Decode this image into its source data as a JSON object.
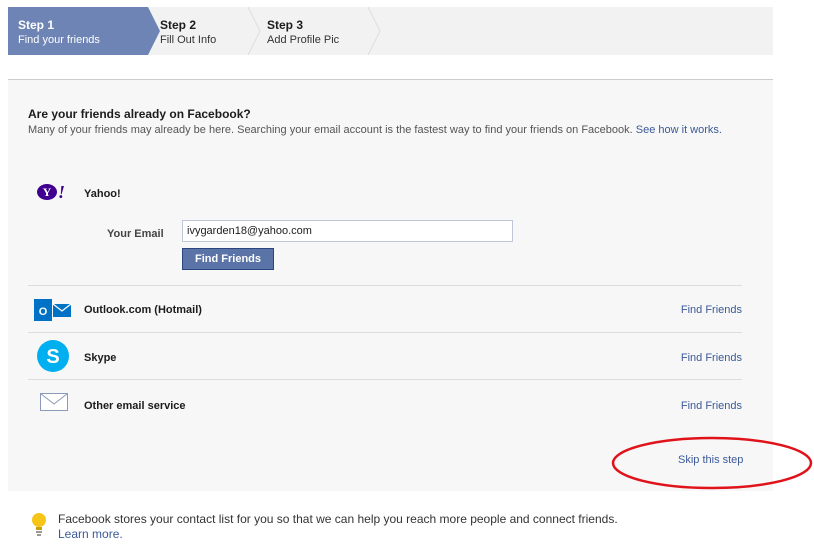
{
  "steps": [
    {
      "num": "Step 1",
      "label": "Find your friends"
    },
    {
      "num": "Step 2",
      "label": "Fill Out Info"
    },
    {
      "num": "Step 3",
      "label": "Add Profile Pic"
    }
  ],
  "main": {
    "heading": "Are your friends already on Facebook?",
    "description": "Many of your friends may already be here. Searching your email account is the fastest way to find your friends on Facebook.",
    "how_link": "See how it works."
  },
  "yahoo": {
    "name": "Yahoo!",
    "email_label": "Your Email",
    "email_value": "ivygarden18@yahoo.com",
    "button_label": "Find Friends"
  },
  "providers": [
    {
      "name": "Outlook.com (Hotmail)",
      "action": "Find Friends",
      "icon": "outlook-icon"
    },
    {
      "name": "Skype",
      "action": "Find Friends",
      "icon": "skype-icon"
    },
    {
      "name": "Other email service",
      "action": "Find Friends",
      "icon": "envelope-icon"
    }
  ],
  "skip_label": "Skip this step",
  "footer": {
    "note": "Facebook stores your contact list for you so that we can help you reach more people and connect friends.",
    "learn_more": "Learn more."
  },
  "colors": {
    "active_step": "#6d84b4",
    "link": "#3b5998",
    "button": "#5b74a8",
    "annotation": "#e0131b"
  }
}
